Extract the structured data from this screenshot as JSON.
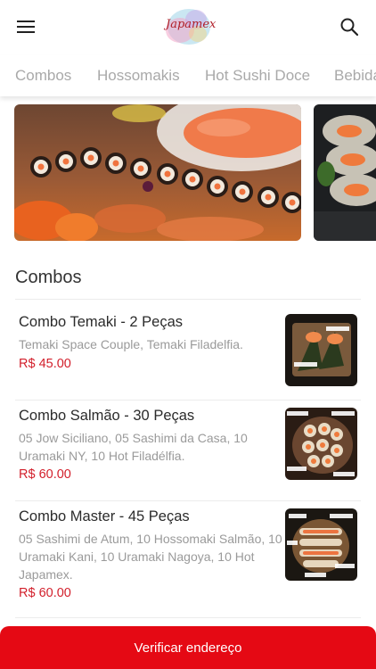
{
  "header": {
    "logo_text": "Japamex",
    "menu_icon": "hamburger-menu-icon",
    "search_icon": "search-icon"
  },
  "tabs": [
    {
      "label": "Combos"
    },
    {
      "label": "Hossomakis"
    },
    {
      "label": "Hot Sushi Doce"
    },
    {
      "label": "Bebidas"
    }
  ],
  "section": {
    "title": "Combos"
  },
  "items": [
    {
      "name": "Combo Temaki - 2 Peças",
      "description": "Temaki Space Couple, Temaki Filadelfia.",
      "price": "R$ 45.00"
    },
    {
      "name": "Combo Salmão - 30 Peças",
      "description": "05 Jow Siciliano, 05 Sashimi da Casa, 10 Uramaki NY, 10 Hot Filadélfia.",
      "price": "R$ 60.00"
    },
    {
      "name": "Combo Master - 45 Peças",
      "description": "05 Sashimi de Atum, 10 Hossomaki Salmão, 10 Uramaki Kani, 10 Uramaki Nagoya, 10 Hot Japamex.",
      "price": "R$ 60.00"
    }
  ],
  "cta": {
    "label": "Verificar endereço"
  },
  "colors": {
    "accent": "#e50914",
    "price": "#d21f2b",
    "tab_text": "#a9a9a9"
  }
}
